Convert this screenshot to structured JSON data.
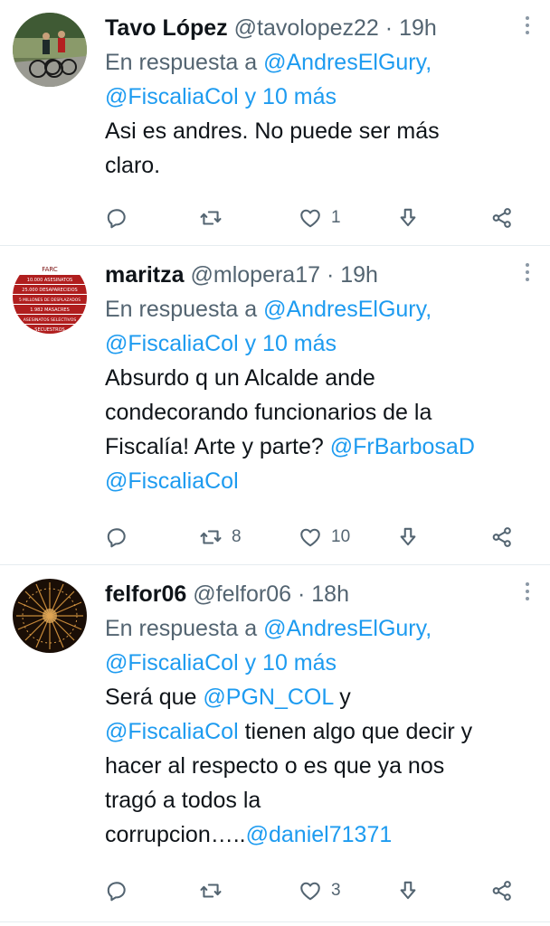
{
  "tweets": [
    {
      "name": "Tavo López",
      "handle": "@tavolopez22",
      "sep": "·",
      "time": "19h",
      "reply_label": "En respuesta a",
      "reply_user": "@AndresElGury,",
      "reply_user2": "@FiscaliaCol",
      "reply_more": "y 10 más",
      "text_1": "Asi es andres. No puede ser más",
      "text_2": "claro.",
      "replies": "",
      "retweets": "",
      "likes": "1"
    },
    {
      "name": "maritza",
      "handle": "@mlopera17",
      "sep": "·",
      "time": "19h",
      "reply_label": "En respuesta a",
      "reply_user": "@AndresElGury,",
      "reply_user2": "@FiscaliaCol",
      "reply_more": "y 10 más",
      "text_1": "Absurdo q un Alcalde ande",
      "text_2": "condecorando funcionarios de la",
      "text_3": "Fiscalía! Arte y parte?",
      "mention_1": "@FrBarbosaD",
      "mention_2": "@FiscaliaCol",
      "avatar_text": {
        "top": "FARC",
        "l1": "10.000 ASESINATOS",
        "l2": "25.000 DESAPARECIDOS",
        "l3": "5 MILLONES DE DESPLAZADOS",
        "l4": "1.982 MASACRES",
        "l5": "ASESINATOS SELECTIVOS",
        "l6": "SECUESTROS"
      },
      "replies": "",
      "retweets": "8",
      "likes": "10"
    },
    {
      "name": "felfor06",
      "handle": "@felfor06",
      "sep": "·",
      "time": "18h",
      "reply_label": "En respuesta a",
      "reply_user": "@AndresElGury,",
      "reply_user2": "@FiscaliaCol",
      "reply_more": "y 10 más",
      "text_1a": "Será que",
      "mention_1": "@PGN_COL",
      "text_1b": " y",
      "mention_2": "@FiscaliaCol",
      "text_2b": "tienen algo que decir y",
      "text_3": "hacer al respecto o es que ya nos",
      "text_4": "tragó a todos la",
      "text_5": "corrupcion…..",
      "mention_3": "@daniel71371",
      "replies": "",
      "retweets": "",
      "likes": "3"
    }
  ],
  "icons": {
    "reply": "reply-icon",
    "retweet": "retweet-icon",
    "like": "heart-icon",
    "download": "download-icon",
    "share": "share-icon",
    "more": "more-icon"
  },
  "colors": {
    "link": "#1d9bf0",
    "muted": "#536471",
    "text": "#0f1419"
  }
}
